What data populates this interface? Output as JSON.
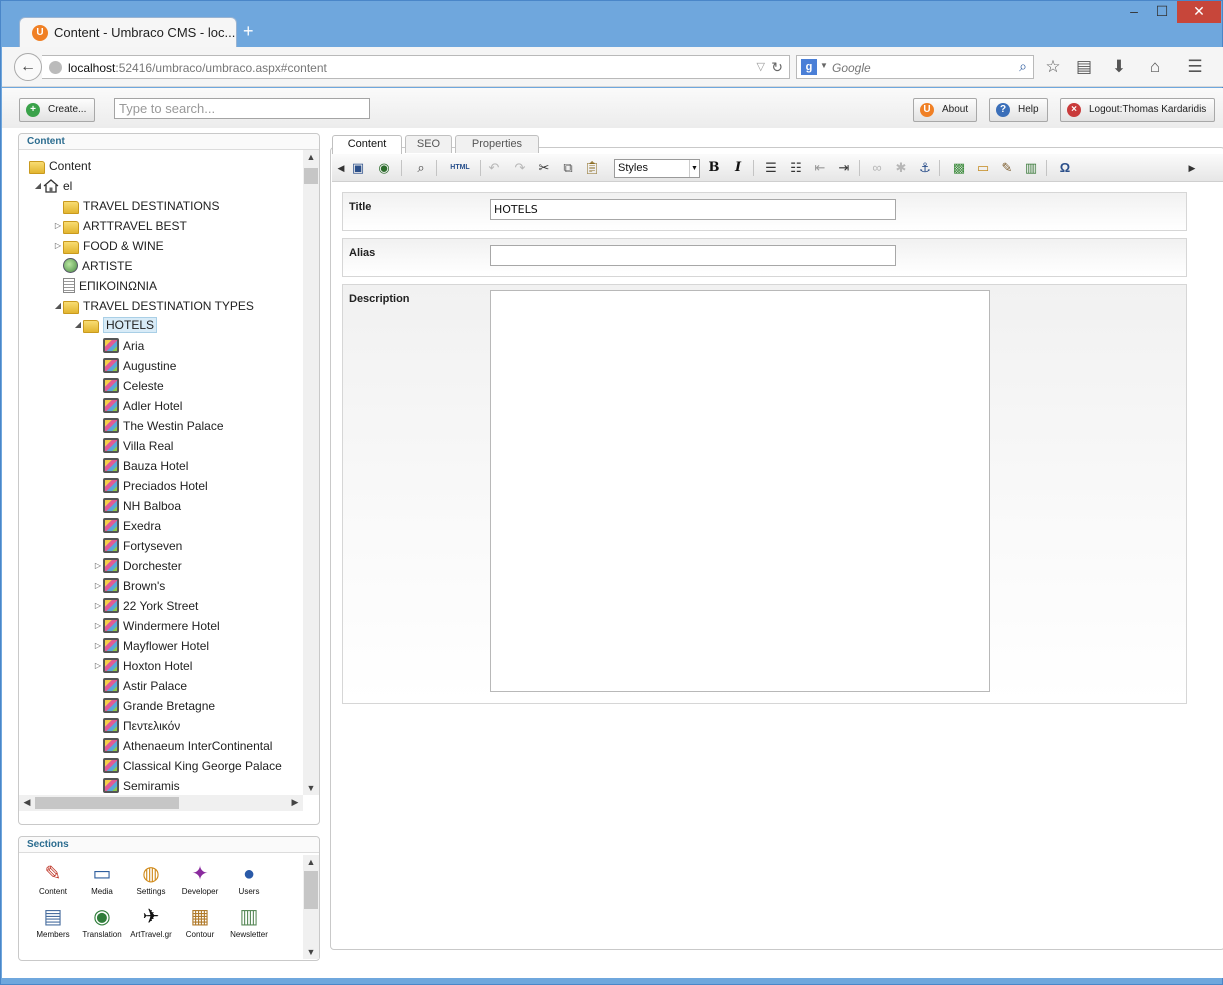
{
  "browser": {
    "tab_title": "Content - Umbraco CMS - loc...",
    "new_tab": "+",
    "url_host": "localhost",
    "url_rest": ":52416/umbraco/umbraco.aspx#content",
    "search_placeholder": "Google",
    "search_engine": "g"
  },
  "topbar": {
    "create_label": "Create...",
    "search_placeholder": "Type to search...",
    "about_label": "About",
    "help_label": "Help",
    "logout_label": "Logout:Thomas Kardaridis"
  },
  "content_panel": {
    "header": "Content",
    "root": "Content",
    "lang_node": "el",
    "items": [
      {
        "label": "TRAVEL DESTINATIONS",
        "icon": "folder"
      },
      {
        "label": "ARTTRAVEL BEST",
        "icon": "folder"
      },
      {
        "label": "FOOD & WINE",
        "icon": "folder"
      },
      {
        "label": "ARTISTE",
        "icon": "globe"
      },
      {
        "label": "ΕΠΙΚΟΙΝΩΝΙΑ",
        "icon": "document"
      },
      {
        "label": "TRAVEL DESTINATION TYPES",
        "icon": "folder"
      }
    ],
    "selected": "HOTELS",
    "hotels": [
      "Aria",
      "Augustine",
      "Celeste",
      "Adler Hotel",
      "The Westin Palace",
      "Villa Real",
      "Bauza Hotel",
      "Preciados Hotel",
      "NH Balboa",
      "Exedra",
      "Fortyseven",
      "Dorchester",
      "Brown's",
      "22 York Street",
      "Windermere Hotel",
      "Mayflower Hotel",
      "Hoxton Hotel",
      "Astir Palace",
      "Grande Bretagne",
      "Πεντελικόν",
      "Athenaeum InterContinental",
      "Classical King George Palace",
      "Semiramis"
    ]
  },
  "sections_panel": {
    "header": "Sections",
    "items": [
      {
        "label": "Content",
        "icon": "pen-icon"
      },
      {
        "label": "Media",
        "icon": "monitor-icon"
      },
      {
        "label": "Settings",
        "icon": "palette-icon"
      },
      {
        "label": "Developer",
        "icon": "wand-icon"
      },
      {
        "label": "Users",
        "icon": "user-icon"
      },
      {
        "label": "Members",
        "icon": "id-card-icon"
      },
      {
        "label": "Translation",
        "icon": "globe-icon"
      },
      {
        "label": "ArtTravel.gr",
        "icon": "airplane-icon"
      },
      {
        "label": "Contour",
        "icon": "clipboard-icon"
      },
      {
        "label": "Newsletter",
        "icon": "newspaper-icon"
      }
    ]
  },
  "editor": {
    "tabs": [
      "Content",
      "SEO",
      "Properties"
    ],
    "toolbar": {
      "styles_label": "Styles",
      "html_label": "HTML",
      "bold": "B",
      "italic": "I",
      "omega": "Ω"
    },
    "fields": {
      "title_label": "Title",
      "title_value": "HOTELS",
      "alias_label": "Alias",
      "alias_value": "",
      "description_label": "Description"
    }
  }
}
